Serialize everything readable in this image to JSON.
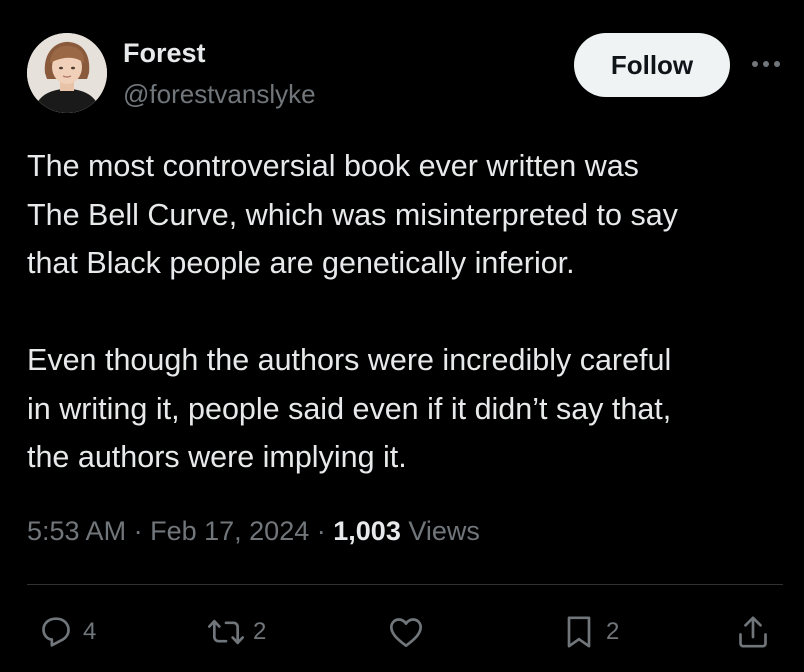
{
  "author": {
    "display_name": "Forest",
    "handle": "@forestvanslyke",
    "avatar_icon": "user-avatar-photo"
  },
  "follow_label": "Follow",
  "more_icon": "more-horizontal-icon",
  "tweet": {
    "paragraphs": [
      [
        "The most controversial book ever written was",
        "The Bell Curve, which was misinterpreted to say",
        "that Black people are genetically inferior."
      ],
      [
        "Even though the authors were incredibly careful",
        "in writing it, people said even if it didn’t say that,",
        "the authors were implying it."
      ]
    ]
  },
  "meta": {
    "time": "5:53 AM",
    "separator": "·",
    "date": "Feb 17, 2024",
    "views_count": "1,003",
    "views_label": "Views"
  },
  "actions": {
    "reply": {
      "icon": "reply-icon",
      "count": "4"
    },
    "repost": {
      "icon": "repost-icon",
      "count": "2"
    },
    "like": {
      "icon": "heart-icon",
      "count": ""
    },
    "bookmark": {
      "icon": "bookmark-icon",
      "count": "2"
    },
    "share": {
      "icon": "share-icon"
    }
  },
  "colors": {
    "background": "#000000",
    "text_primary": "#e7e9ea",
    "text_secondary": "#71767b",
    "divider": "#2f3336",
    "follow_bg": "#eff3f4"
  }
}
